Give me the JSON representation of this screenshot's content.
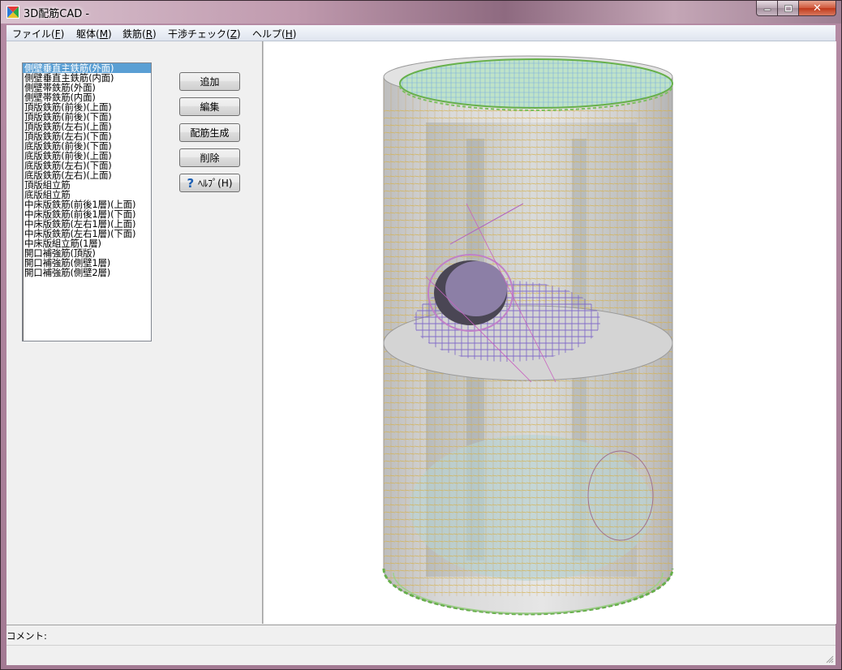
{
  "window": {
    "title": "3D配筋CAD -"
  },
  "menu": [
    {
      "label": "ファイル(",
      "key": "F",
      "tail": ")"
    },
    {
      "label": "躯体(",
      "key": "M",
      "tail": ")"
    },
    {
      "label": "鉄筋(",
      "key": "R",
      "tail": ")"
    },
    {
      "label": "干渉チェック(",
      "key": "Z",
      "tail": ")"
    },
    {
      "label": "ヘルプ(",
      "key": "H",
      "tail": ")"
    }
  ],
  "list": {
    "selected_index": 0,
    "items": [
      "側壁垂直主鉄筋(外面)",
      "側壁垂直主鉄筋(内面)",
      "側壁帯鉄筋(外面)",
      "側壁帯鉄筋(内面)",
      "頂版鉄筋(前後)(上面)",
      "頂版鉄筋(前後)(下面)",
      "頂版鉄筋(左右)(上面)",
      "頂版鉄筋(左右)(下面)",
      "底版鉄筋(前後)(下面)",
      "底版鉄筋(前後)(上面)",
      "底版鉄筋(左右)(下面)",
      "底版鉄筋(左右)(上面)",
      "頂版組立筋",
      "底版組立筋",
      "中床版鉄筋(前後1層)(上面)",
      "中床版鉄筋(前後1層)(下面)",
      "中床版鉄筋(左右1層)(上面)",
      "中床版鉄筋(左右1層)(下面)",
      "中床版組立筋(1層)",
      "開口補強筋(頂版)",
      "開口補強筋(側壁1層)",
      "開口補強筋(側壁2層)"
    ]
  },
  "buttons": {
    "add": "追加",
    "edit": "編集",
    "generate": "配筋生成",
    "delete": "削除",
    "help": "ﾍﾙﾌﾟ(H)"
  },
  "comment": {
    "label": "コメント:"
  }
}
